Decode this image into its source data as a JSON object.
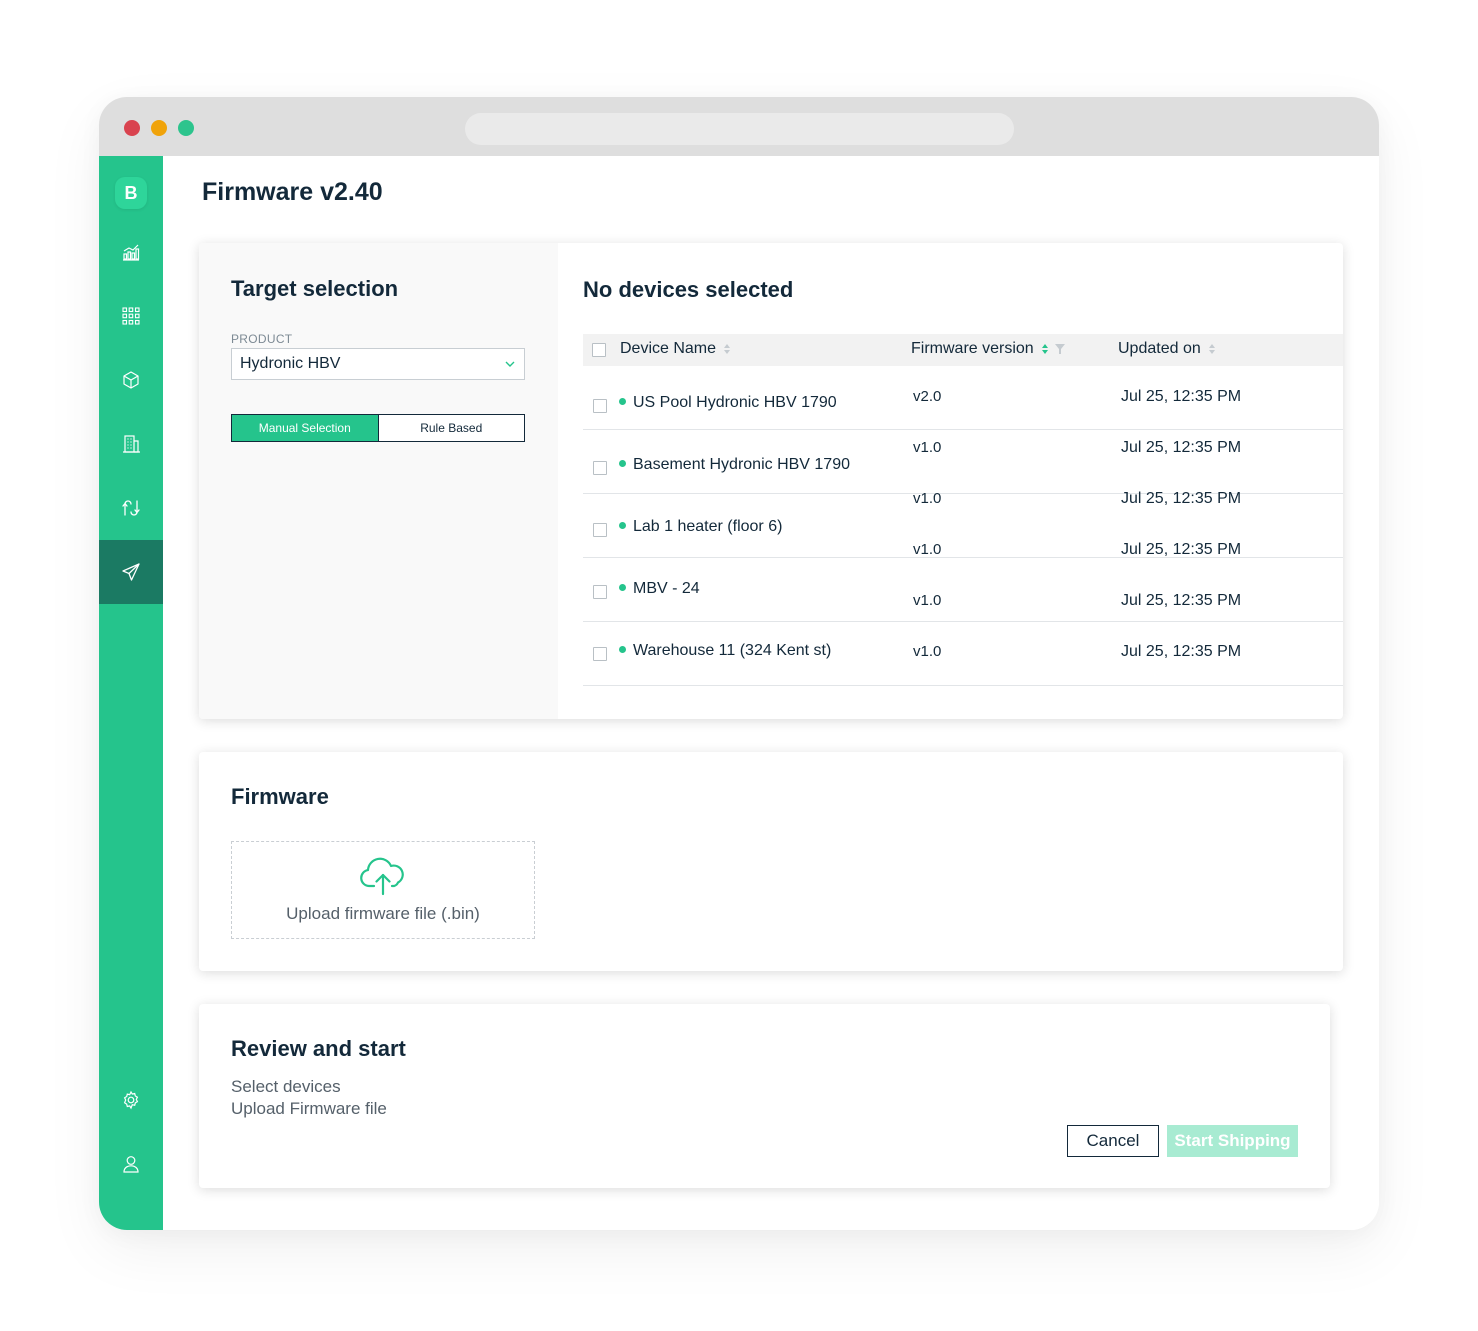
{
  "logo": {
    "letter": "B"
  },
  "page": {
    "title": "Firmware v2.40"
  },
  "target": {
    "title": "Target selection",
    "product_label": "PRODUCT",
    "product_value": "Hydronic HBV",
    "mode_buttons": [
      "Manual Selection",
      "Rule Based"
    ],
    "selected_mode": "Manual Selection"
  },
  "devices": {
    "title": "No devices selected",
    "columns": [
      "Device Name",
      "Firmware version",
      "Updated on"
    ],
    "rows": [
      {
        "name": "US Pool Hydronic HBV 1790",
        "firmware": "v2.0",
        "updated": "Jul 25, 12:35 PM"
      },
      {
        "name": "Basement Hydronic HBV 1790",
        "firmware": "v1.0",
        "updated": "Jul 25, 12:35 PM"
      },
      {
        "name": "Lab 1 heater (floor 6)",
        "firmware": "v1.0",
        "updated": "Jul 25, 12:35 PM"
      },
      {
        "name": "MBV - 24",
        "firmware": "v1.0",
        "updated": "Jul 25, 12:35 PM"
      },
      {
        "name": "Warehouse 11 (324 Kent st)",
        "firmware": "v1.0",
        "updated": "Jul 25, 12:35 PM"
      },
      {
        "name": "",
        "firmware": "v1.0",
        "updated": "Jul 25, 12:35 PM"
      }
    ]
  },
  "firmware": {
    "title": "Firmware",
    "upload_label": "Upload firmware file (.bin)"
  },
  "review": {
    "title": "Review and start",
    "steps": [
      "Select devices",
      "Upload Firmware file"
    ],
    "cancel_label": "Cancel",
    "start_label": "Start Shipping"
  },
  "colors": {
    "accent": "#25c48c",
    "sidebar_active": "#1b7a63",
    "text_dark": "#13293a",
    "start_disabled": "#a8ebd2"
  },
  "icons": {
    "sidebar": [
      "analytics-icon",
      "grid-icon",
      "box-icon",
      "building-icon",
      "transfer-icon",
      "send-icon",
      "gear-icon",
      "user-icon"
    ],
    "upload": "cloud-upload-icon"
  }
}
